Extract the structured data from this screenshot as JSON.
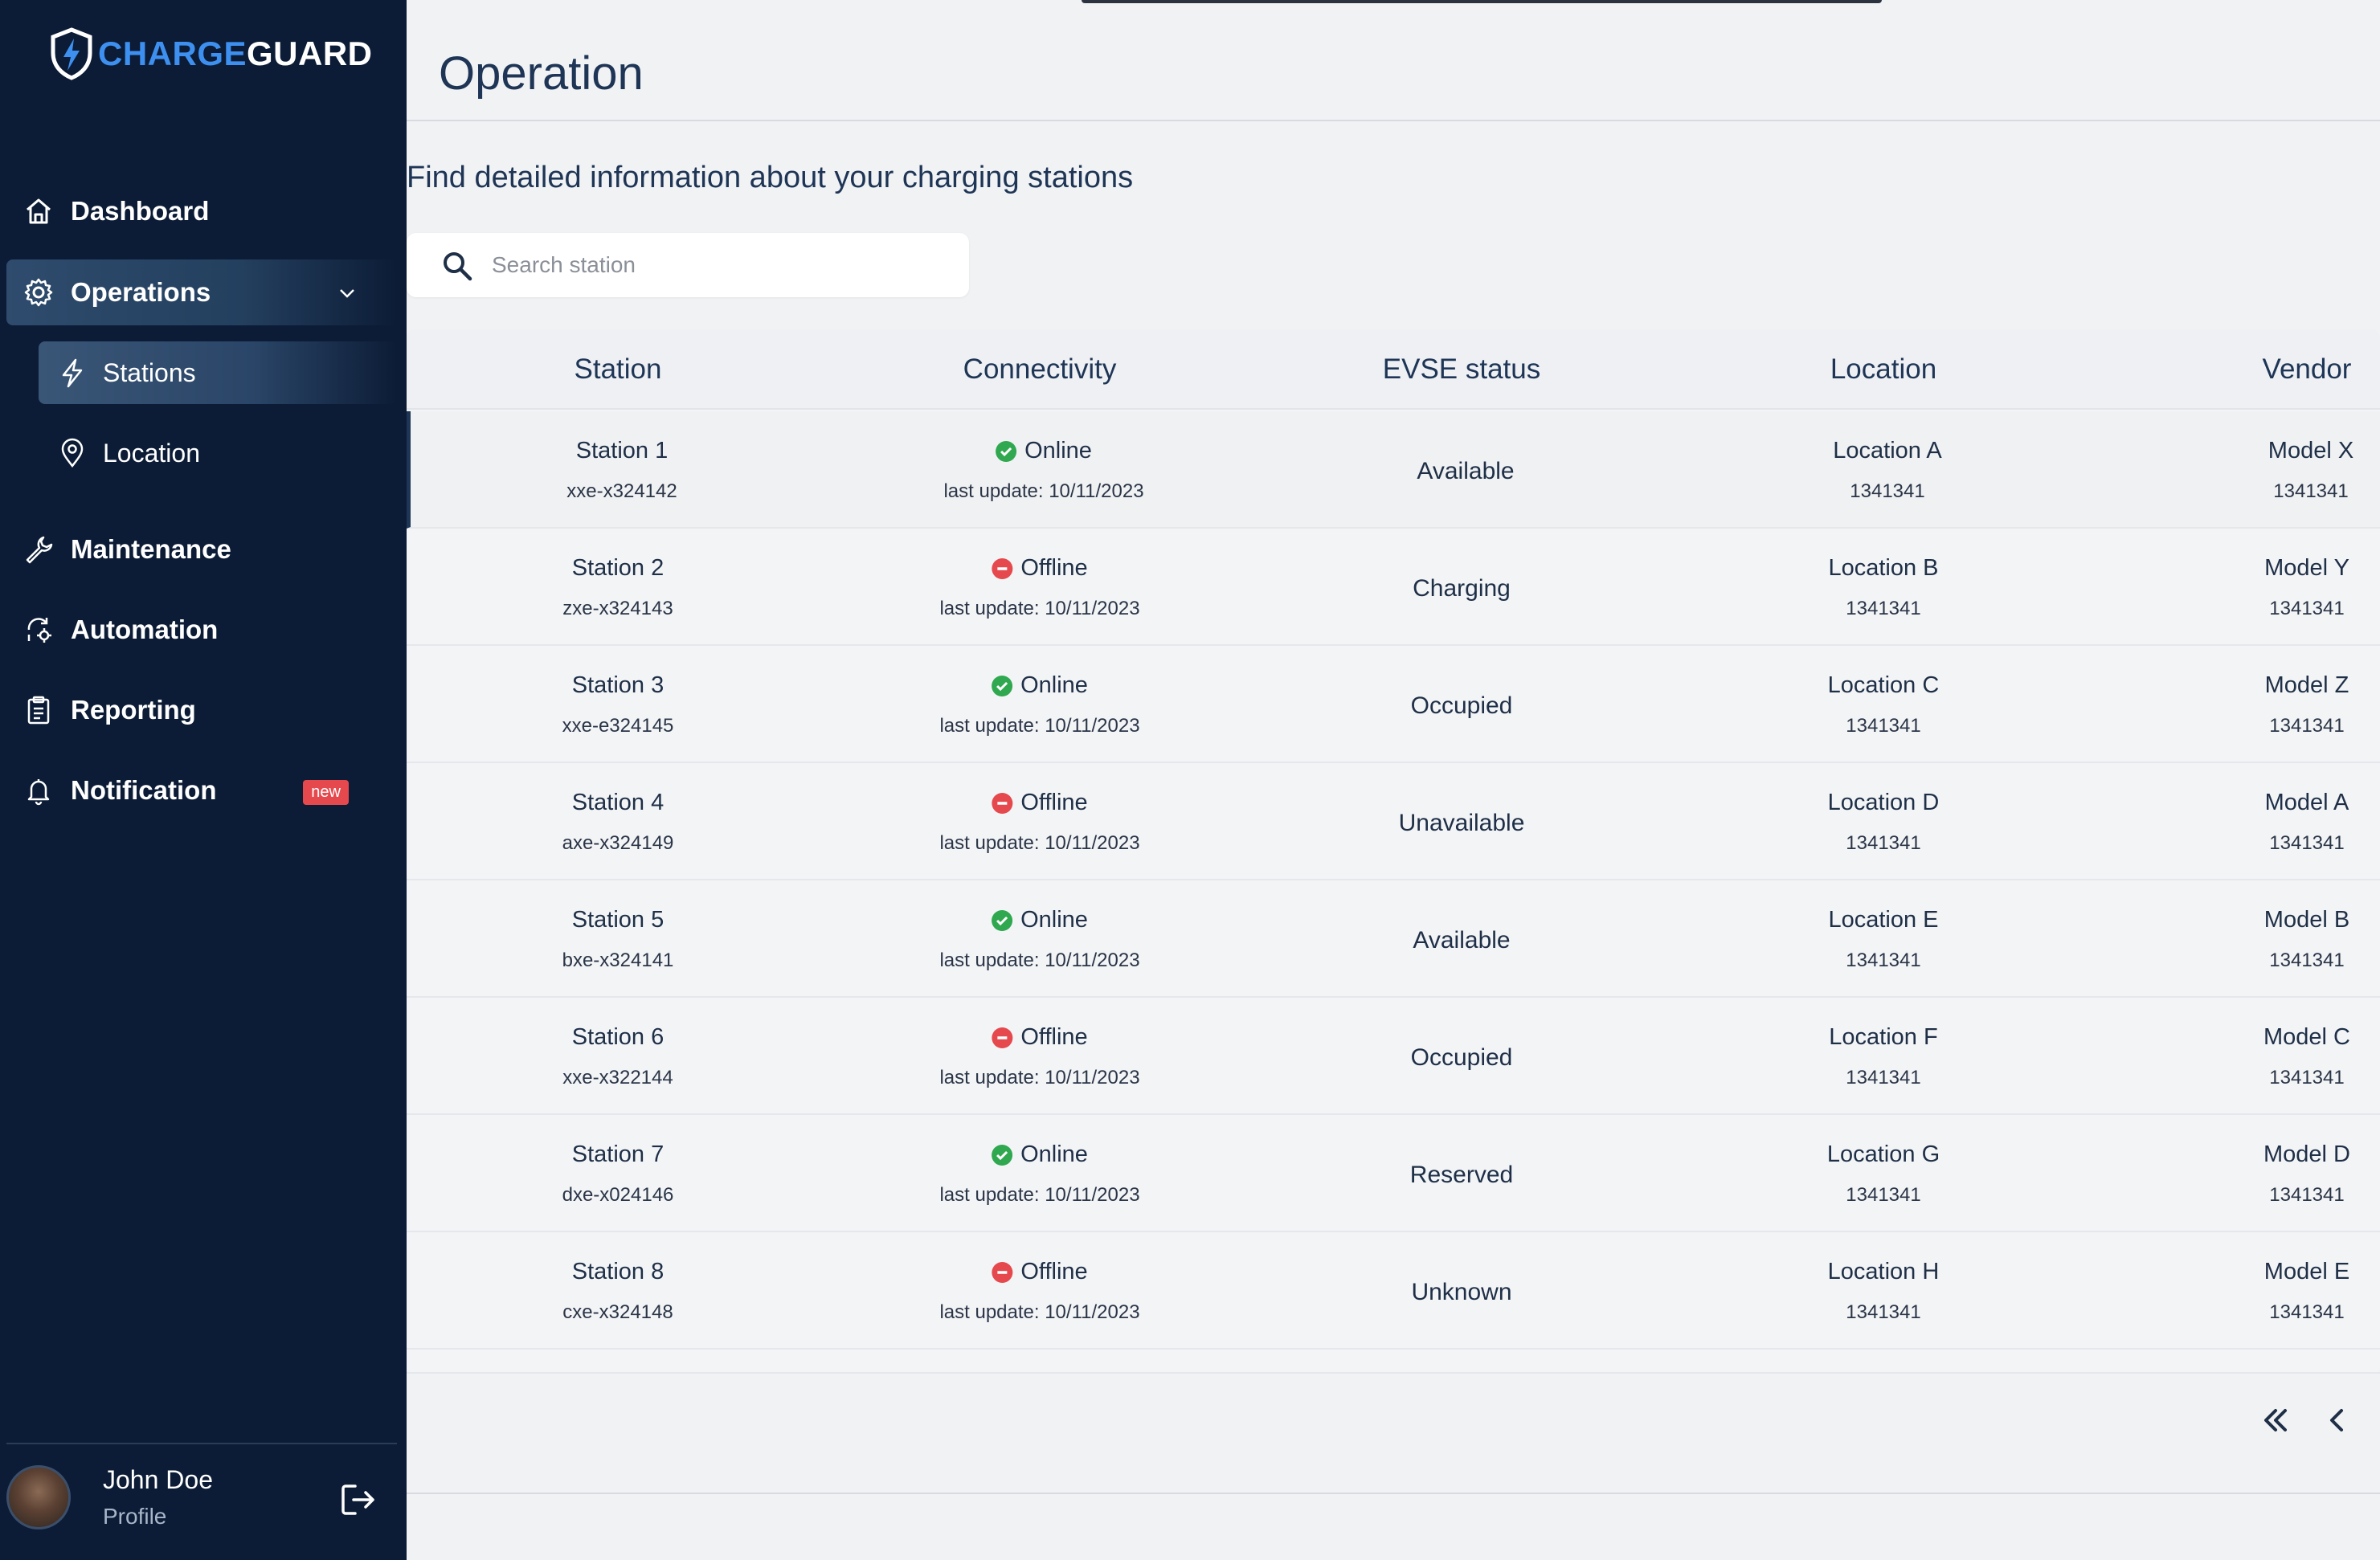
{
  "brand": {
    "part1": "CHARGE",
    "part2": "GUARD",
    "accent": "#3e90f0"
  },
  "sidebar": {
    "items": [
      {
        "label": "Dashboard",
        "icon": "home-icon"
      },
      {
        "label": "Operations",
        "icon": "gear-icon",
        "expanded": true
      },
      {
        "label": "Maintenance",
        "icon": "wrench-icon"
      },
      {
        "label": "Automation",
        "icon": "automation-icon"
      },
      {
        "label": "Reporting",
        "icon": "clipboard-icon"
      },
      {
        "label": "Notification",
        "icon": "bell-icon",
        "badge": "new"
      }
    ],
    "sub_items": [
      {
        "label": "Stations",
        "icon": "bolt-icon",
        "active": true
      },
      {
        "label": "Location",
        "icon": "map-pin-icon"
      }
    ],
    "user": {
      "name": "John Doe",
      "role": "Profile"
    }
  },
  "main": {
    "title": "Operation",
    "subtitle": "Find detailed information about your charging stations",
    "search": {
      "placeholder": "Search station",
      "value": ""
    },
    "table": {
      "headers": [
        "Station",
        "Connectivity",
        "EVSE status",
        "Location",
        "Vendor"
      ],
      "rows": [
        {
          "station": "Station 1",
          "id": "xxe-x324142",
          "connectivity": "Online",
          "update": "last update: 10/11/2023",
          "evse": "Available",
          "location": "Location A",
          "location_id": "1341341",
          "vendor": "Model X",
          "vendor_id": "1341341"
        },
        {
          "station": "Station 2",
          "id": "zxe-x324143",
          "connectivity": "Offline",
          "update": "last update: 10/11/2023",
          "evse": "Charging",
          "location": "Location B",
          "location_id": "1341341",
          "vendor": "Model Y",
          "vendor_id": "1341341"
        },
        {
          "station": "Station 3",
          "id": "xxe-e324145",
          "connectivity": "Online",
          "update": "last update: 10/11/2023",
          "evse": "Occupied",
          "location": "Location C",
          "location_id": "1341341",
          "vendor": "Model Z",
          "vendor_id": "1341341"
        },
        {
          "station": "Station 4",
          "id": "axe-x324149",
          "connectivity": "Offline",
          "update": "last update: 10/11/2023",
          "evse": "Unavailable",
          "location": "Location D",
          "location_id": "1341341",
          "vendor": "Model A",
          "vendor_id": "1341341"
        },
        {
          "station": "Station 5",
          "id": "bxe-x324141",
          "connectivity": "Online",
          "update": "last update: 10/11/2023",
          "evse": "Available",
          "location": "Location E",
          "location_id": "1341341",
          "vendor": "Model B",
          "vendor_id": "1341341"
        },
        {
          "station": "Station 6",
          "id": "xxe-x322144",
          "connectivity": "Offline",
          "update": "last update: 10/11/2023",
          "evse": "Occupied",
          "location": "Location F",
          "location_id": "1341341",
          "vendor": "Model C",
          "vendor_id": "1341341"
        },
        {
          "station": "Station 7",
          "id": "dxe-x024146",
          "connectivity": "Online",
          "update": "last update: 10/11/2023",
          "evse": "Reserved",
          "location": "Location G",
          "location_id": "1341341",
          "vendor": "Model D",
          "vendor_id": "1341341"
        },
        {
          "station": "Station 8",
          "id": "cxe-x324148",
          "connectivity": "Offline",
          "update": "last update: 10/11/2023",
          "evse": "Unknown",
          "location": "Location H",
          "location_id": "1341341",
          "vendor": "Model E",
          "vendor_id": "1341341"
        }
      ]
    },
    "pagination": {
      "first_icon": "double-chevron-left-icon",
      "prev_icon": "chevron-left-icon"
    }
  },
  "colors": {
    "sidebar_bg": "#0c1c36",
    "online": "#2fa84f",
    "offline": "#e5484d",
    "badge": "#e5484d"
  }
}
